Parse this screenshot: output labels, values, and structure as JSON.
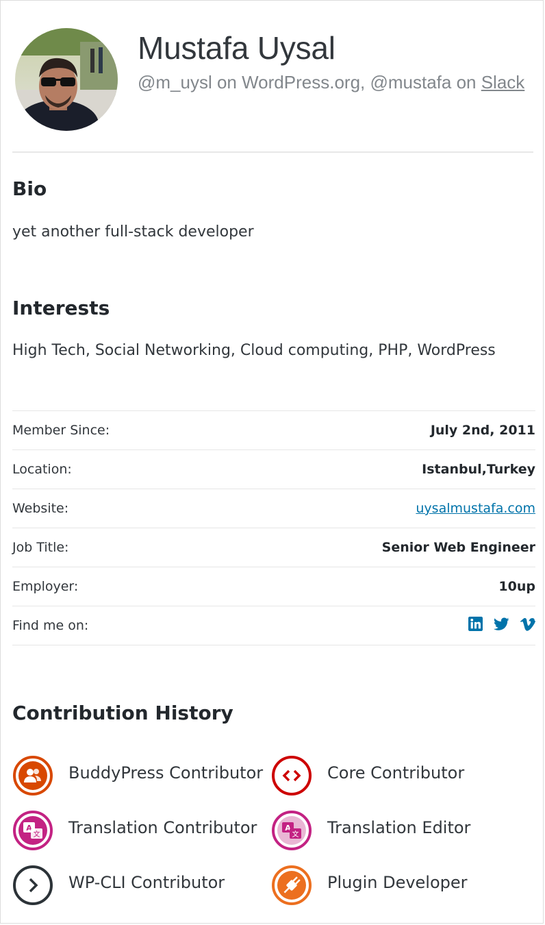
{
  "profile": {
    "name": "Mustafa Uysal",
    "handle_prefix": "@m_uysl on WordPress.org, @mustafa on ",
    "slack_link": "Slack"
  },
  "bio": {
    "title": "Bio",
    "text": "yet another full-stack developer"
  },
  "interests": {
    "title": "Interests",
    "text": "High Tech, Social Networking, Cloud computing, PHP, WordPress"
  },
  "details": {
    "member_since": {
      "label": "Member Since:",
      "value": "July 2nd, 2011"
    },
    "location": {
      "label": "Location:",
      "value": "Istanbul,Turkey"
    },
    "website": {
      "label": "Website:",
      "value": "uysalmustafa.com"
    },
    "job_title": {
      "label": "Job Title:",
      "value": "Senior Web Engineer"
    },
    "employer": {
      "label": "Employer:",
      "value": "10up"
    },
    "find_me": {
      "label": "Find me on:",
      "icons": [
        "linkedin-icon",
        "twitter-icon",
        "vimeo-icon"
      ]
    }
  },
  "contribution": {
    "title": "Contribution History",
    "items": [
      {
        "label": "BuddyPress Contributor",
        "icon": "buddypress-icon",
        "color": "#d84800"
      },
      {
        "label": "Core Contributor",
        "icon": "code-icon",
        "color": "#cd0000"
      },
      {
        "label": "Translation Contributor",
        "icon": "translation-icon",
        "color": "#c32283"
      },
      {
        "label": "Translation Editor",
        "icon": "translation-icon",
        "color": "#c32283"
      },
      {
        "label": "WP-CLI Contributor",
        "icon": "chevron-right-icon",
        "color": "#2c3338"
      },
      {
        "label": "Plugin Developer",
        "icon": "plug-icon",
        "color": "#ec6f1f"
      }
    ]
  },
  "colors": {
    "link": "#0073aa",
    "text": "#23282d",
    "muted": "#82878c"
  }
}
